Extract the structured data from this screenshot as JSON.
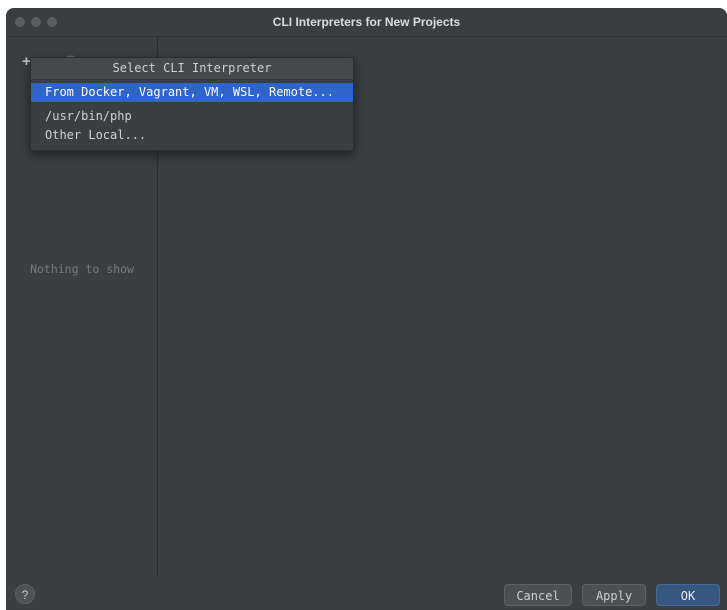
{
  "window": {
    "title": "CLI Interpreters for New Projects"
  },
  "toolbar": {
    "add_icon": "plus-icon",
    "remove_icon": "minus-icon",
    "copy_icon": "copy-icon"
  },
  "left_panel": {
    "empty_text": "Nothing to show"
  },
  "popup": {
    "header": "Select CLI Interpreter",
    "items": [
      {
        "label": "From Docker, Vagrant, VM, WSL, Remote...",
        "selected": true
      },
      {
        "label": "/usr/bin/php",
        "selected": false
      },
      {
        "label": "Other Local...",
        "selected": false
      }
    ]
  },
  "footer": {
    "help_label": "?",
    "cancel_label": "Cancel",
    "apply_label": "Apply",
    "ok_label": "OK"
  },
  "colors": {
    "accent": "#2f65ca",
    "background": "#3c3f41",
    "ok_button": "#365880"
  }
}
